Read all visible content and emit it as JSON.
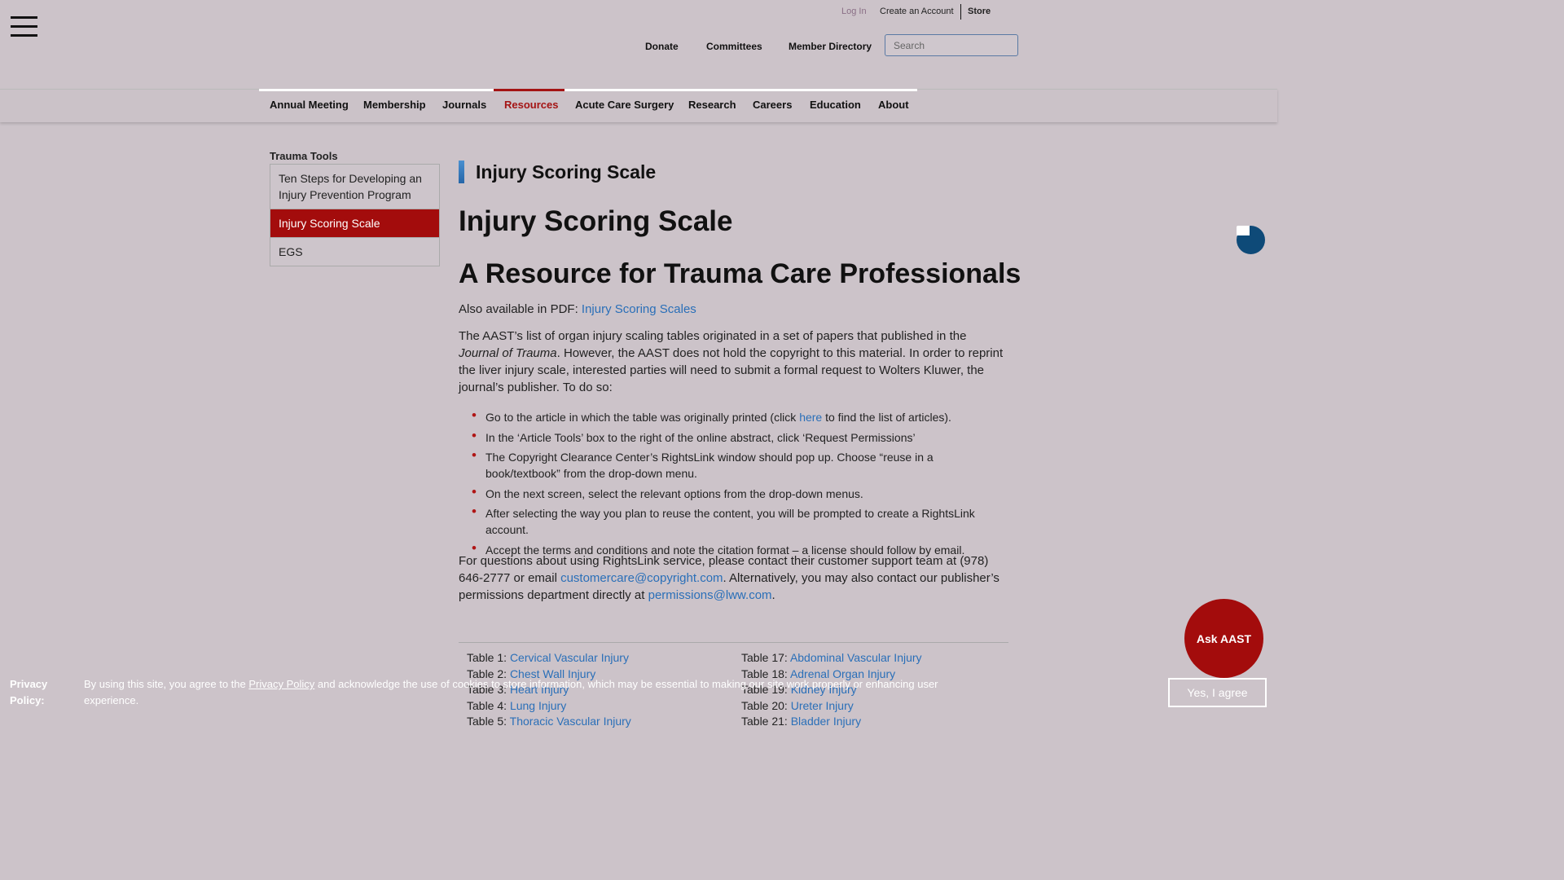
{
  "utility": {
    "login": "Log In",
    "create": "Create an Account",
    "store": "Store"
  },
  "topnav": {
    "donate": "Donate",
    "committees": "Committees",
    "directory": "Member Directory"
  },
  "search": {
    "placeholder": "Search"
  },
  "mainnav": [
    "Annual Meeting",
    "Membership",
    "Journals",
    "Resources",
    "Acute Care Surgery",
    "Research",
    "Careers",
    "Education",
    "About"
  ],
  "sidebar": {
    "title": "Trauma Tools",
    "items": [
      "Ten Steps for Developing an Injury Prevention Program",
      "Injury Scoring Scale",
      "EGS"
    ]
  },
  "page": {
    "breadcrumb_title": "Injury Scoring Scale",
    "h1": "Injury Scoring Scale",
    "h2": "A Resource for Trauma Care Professionals",
    "pdf_prefix": "Also available in PDF: ",
    "pdf_link": "Injury Scoring Scales",
    "intro_1": "The AAST’s list of organ injury scaling tables originated in a set of papers that published in the ",
    "intro_journal": "Journal of Trauma",
    "intro_2": ". However, the AAST does not hold the copyright to this material. In order to reprint the liver injury scale, interested parties will need to submit a formal request to Wolters Kluwer, the journal’s publisher. To do so:",
    "step1_a": "Go to the article in which the table was originally printed (click ",
    "step1_link": "here",
    "step1_b": " to find the list of articles).",
    "step2": "In the ‘Article Tools’ box to the right of the online abstract, click ‘Request Permissions’",
    "step3": "The Copyright Clearance Center’s RightsLink window should pop up. Choose “reuse in a book/textbook” from the drop-down menu.",
    "step4": "On the next screen, select the relevant options from the drop-down menus.",
    "step5": "After selecting the way you plan to reuse the content, you will be prompted to create a RightsLink account.",
    "step6": "Accept the terms and conditions and note the citation format – a license should follow by email.",
    "contact_1": "For questions about using RightsLink service, please contact their customer support team at (978) 646-2777 or email ",
    "contact_email1": "customercare@copyright.com",
    "contact_2": ". Alternatively, you may also contact our publisher’s permissions department directly at ",
    "contact_email2": "permissions@lww.com",
    "contact_3": "."
  },
  "tables_left": [
    {
      "label": "Table 1: ",
      "name": "Cervical Vascular Injury"
    },
    {
      "label": "Table 2: ",
      "name": "Chest Wall Injury"
    },
    {
      "label": "Table 3: ",
      "name": "Heart Injury"
    },
    {
      "label": "Table 4: ",
      "name": "Lung Injury"
    },
    {
      "label": "Table 5: ",
      "name": "Thoracic Vascular Injury"
    }
  ],
  "tables_right": [
    {
      "label": "Table 17: ",
      "name": "Abdominal Vascular Injury"
    },
    {
      "label": "Table 18: ",
      "name": "Adrenal Organ Injury"
    },
    {
      "label": "Table 19: ",
      "name": "Kidney Injury"
    },
    {
      "label": "Table 20: ",
      "name": "Ureter Injury"
    },
    {
      "label": "Table 21: ",
      "name": "Bladder Injury"
    }
  ],
  "ask": "Ask AAST",
  "privacy": {
    "label": "Privacy Policy:",
    "text_1": "By using this site, you agree to the ",
    "link": "Privacy Policy",
    "text_2": " and acknowledge the use of cookies to store information, which may be essential to making our site work properly or enhancing user experience.",
    "button": "Yes, I agree"
  }
}
